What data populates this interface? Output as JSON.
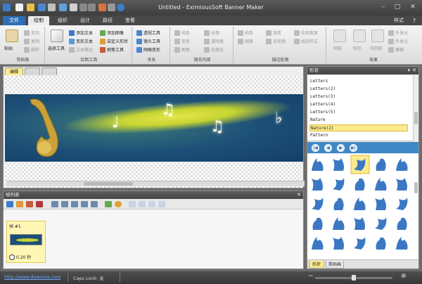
{
  "window": {
    "title": "Untitled - EximiousSoft Banner Maker",
    "style_label": "样式"
  },
  "tabs": [
    {
      "label": "文件"
    },
    {
      "label": "绘制"
    },
    {
      "label": "组织"
    },
    {
      "label": "设计"
    },
    {
      "label": "路径"
    },
    {
      "label": "查看"
    }
  ],
  "ribbon": {
    "clipboard": {
      "label": "剪贴板",
      "paste": "粘贴",
      "cut": "剪切",
      "copy": "复制",
      "delete": "删除"
    },
    "draw_tools": {
      "label": "绘制工具",
      "select": "选择工具",
      "add_text": "添加文本",
      "deform_text": "变形文本",
      "text_path": "文本路径",
      "add_image": "添加图像",
      "custom_shape": "自定义形状",
      "brush": "刷笔工具"
    },
    "gradient": {
      "label": "关系",
      "perspective": "透视工具",
      "lens": "镜头工具",
      "mesh": "网格变形"
    },
    "fill": {
      "label": "填充内部",
      "color": "纯色",
      "gradient": "渐变",
      "pattern": "图案",
      "texture": "纹理",
      "transparent": "透明度",
      "none": "无填充"
    },
    "outline": {
      "label": "描边轮廓",
      "color": "纯色",
      "gradient": "渐变",
      "pattern": "图案",
      "line_width": "轮廓宽度",
      "line_style": "线段样式",
      "none": "无轮廓"
    },
    "effects": {
      "label": "效果",
      "shadow": "阴影",
      "glow": "外发光",
      "bevel": "斜切",
      "inner": "内阴影",
      "outer": "外发光",
      "blur": "模糊"
    }
  },
  "editor": {
    "tab1": "编辑",
    "tab2": "",
    "tab3": ""
  },
  "frames": {
    "title": "帧列表",
    "frame_name": "帧 #1",
    "duration": "0.20 秒"
  },
  "shapes_panel": {
    "title": "形状",
    "items": [
      "Letters",
      "Letters(2)",
      "Letters(3)",
      "Letters(4)",
      "Letters(5)",
      "Nature",
      "Nature(2)",
      "Pattern"
    ],
    "selected_index": 6,
    "tab_shapes": "形状",
    "tab_clipart": "剪贴画"
  },
  "status": {
    "link": "http://www.downxia.com",
    "caps": "Caps Lock: 关"
  },
  "colors": {
    "accent": "#2f6db5",
    "banner_bg": "#1c4f77",
    "shape_blue": "#3b78c4",
    "selected": "#fbeb8c"
  }
}
